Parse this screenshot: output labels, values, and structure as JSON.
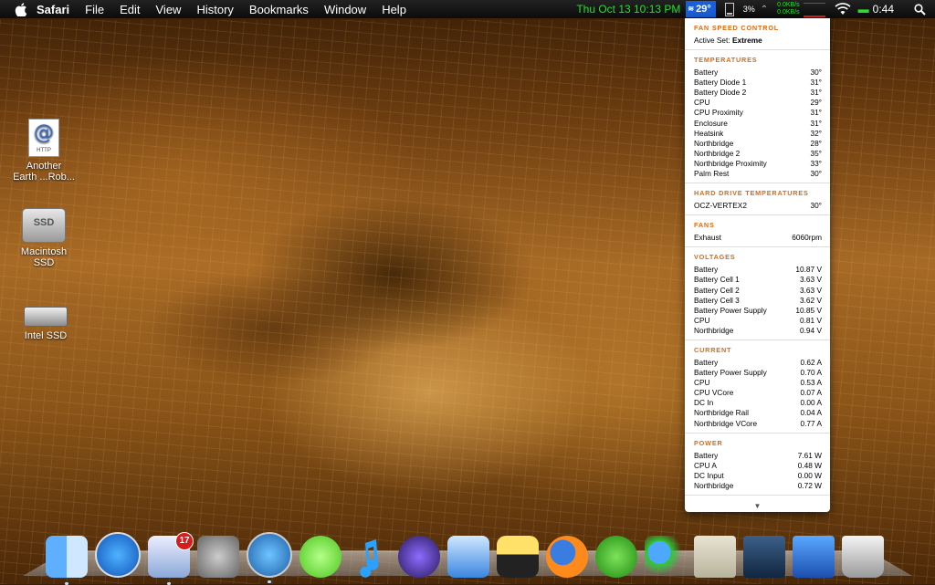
{
  "menubar": {
    "apple_icon": "apple-icon",
    "app_name": "Safari",
    "items": [
      "File",
      "Edit",
      "View",
      "History",
      "Bookmarks",
      "Window",
      "Help"
    ],
    "clock": "Thu Oct 13  10:13 PM",
    "temp_badge": "29°",
    "battery_percent": "3%",
    "net_up": "0.0KB/s",
    "net_down": "0.0KB/s",
    "battery_time": "0:44"
  },
  "desktop": {
    "icons": [
      {
        "label_line1": "Another",
        "label_line2": "Earth ...Rob...",
        "doc_tag": "HTTP",
        "glyph": "@"
      },
      {
        "label_line1": "Macintosh",
        "label_line2": "SSD",
        "drive_text": "SSD"
      },
      {
        "label_line1": "Intel SSD"
      }
    ]
  },
  "panel": {
    "fan_control": {
      "title": "FAN SPEED CONTROL",
      "active_label": "Active Set:",
      "active_value": "Extreme"
    },
    "temperatures": {
      "title": "TEMPERATURES",
      "rows": [
        {
          "name": "Battery",
          "value": "30°"
        },
        {
          "name": "Battery Diode 1",
          "value": "31°"
        },
        {
          "name": "Battery Diode 2",
          "value": "31°"
        },
        {
          "name": "CPU",
          "value": "29°"
        },
        {
          "name": "CPU Proximity",
          "value": "31°"
        },
        {
          "name": "Enclosure",
          "value": "31°"
        },
        {
          "name": "Heatsink",
          "value": "32°"
        },
        {
          "name": "Northbridge",
          "value": "28°"
        },
        {
          "name": "Northbridge 2",
          "value": "35°"
        },
        {
          "name": "Northbridge Proximity",
          "value": "33°"
        },
        {
          "name": "Palm Rest",
          "value": "30°"
        }
      ]
    },
    "hdd": {
      "title": "HARD DRIVE TEMPERATURES",
      "rows": [
        {
          "name": "OCZ-VERTEX2",
          "value": "30°"
        }
      ]
    },
    "fans": {
      "title": "FANS",
      "rows": [
        {
          "name": "Exhaust",
          "value": "6060rpm"
        }
      ]
    },
    "voltages": {
      "title": "VOLTAGES",
      "rows": [
        {
          "name": "Battery",
          "value": "10.87 V"
        },
        {
          "name": "Battery Cell 1",
          "value": "3.63 V"
        },
        {
          "name": "Battery Cell 2",
          "value": "3.63 V"
        },
        {
          "name": "Battery Cell 3",
          "value": "3.62 V"
        },
        {
          "name": "Battery Power Supply",
          "value": "10.85 V"
        },
        {
          "name": "CPU",
          "value": "0.81 V"
        },
        {
          "name": "Northbridge",
          "value": "0.94 V"
        }
      ]
    },
    "current": {
      "title": "CURRENT",
      "rows": [
        {
          "name": "Battery",
          "value": "0.62 A"
        },
        {
          "name": "Battery Power Supply",
          "value": "0.70 A"
        },
        {
          "name": "CPU",
          "value": "0.53 A"
        },
        {
          "name": "CPU VCore",
          "value": "0.07 A"
        },
        {
          "name": "DC In",
          "value": "0.00 A"
        },
        {
          "name": "Northbridge Rail",
          "value": "0.04 A"
        },
        {
          "name": "Northbridge VCore",
          "value": "0.77 A"
        }
      ]
    },
    "power": {
      "title": "POWER",
      "rows": [
        {
          "name": "Battery",
          "value": "7.61 W"
        },
        {
          "name": "CPU A",
          "value": "0.48 W"
        },
        {
          "name": "DC Input",
          "value": "0.00 W"
        },
        {
          "name": "Northbridge",
          "value": "0.72 W"
        }
      ]
    },
    "scroll_arrow": "▼"
  },
  "dock": {
    "mail_badge": "17",
    "items": [
      "finder-icon",
      "app-store-icon",
      "mail-icon",
      "system-preferences-icon",
      "safari-icon",
      "skype-icon",
      "music-note-icon",
      "itunes-icon",
      "word-icon",
      "clock-widget-icon",
      "firefox-icon",
      "utorrent-icon",
      "messenger-icon",
      "classic-mac-icon",
      "applications-folder-icon",
      "downloads-icon",
      "trash-icon"
    ]
  }
}
